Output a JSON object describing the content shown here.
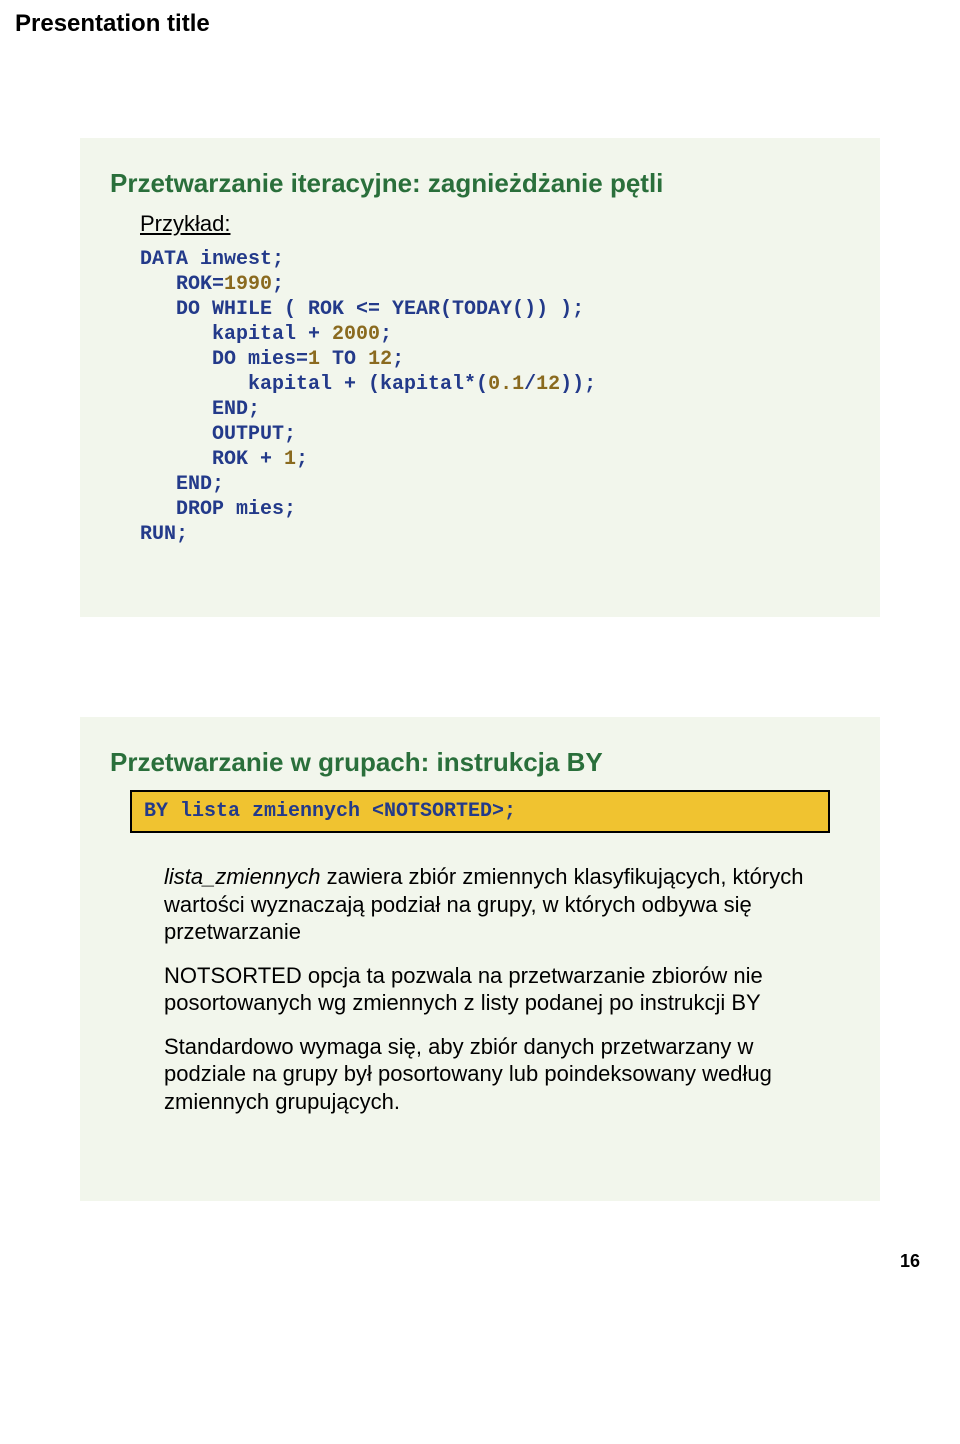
{
  "header": {
    "title": "Presentation title"
  },
  "slide1": {
    "title": "Przetwarzanie iteracyjne: zagnieżdżanie pętli",
    "example_label": "Przykład:",
    "code": {
      "l1a": "DATA",
      "l1b": " inwest;",
      "l2a": "   ROK=",
      "l2b": "1990",
      "l2c": ";",
      "l3a": "   DO WHILE ( ROK <= YEAR(TODAY()) );",
      "l4a": "      kapital + ",
      "l4b": "2000",
      "l4c": ";",
      "l5a": "      DO mies=",
      "l5b": "1",
      "l5c": " TO ",
      "l5d": "12",
      "l5e": ";",
      "l6a": "         kapital + (kapital*(",
      "l6b": "0.1",
      "l6c": "/",
      "l6d": "12",
      "l6e": "));",
      "l7": "      END;",
      "l8": "      OUTPUT;",
      "l9a": "      ROK + ",
      "l9b": "1",
      "l9c": ";",
      "l10": "   END;",
      "l11": "   DROP mies;",
      "l12": "RUN;"
    }
  },
  "slide2": {
    "title": "Przetwarzanie w grupach: instrukcja BY",
    "by_box": "BY lista zmiennych <NOTSORTED>;",
    "p1_term": "lista_zmiennych",
    "p1_rest": "      zawiera zbiór zmiennych klasyfikujących, których wartości wyznaczają podział na grupy, w których odbywa się przetwarzanie",
    "p2_term": "NOTSORTED",
    "p2_rest": "       opcja ta pozwala na przetwarzanie zbiorów nie posortowanych wg zmiennych z listy podanej po instrukcji BY",
    "p3": "Standardowo wymaga się, aby zbiór danych przetwarzany w podziale na grupy był posortowany lub poindeksowany według zmiennych grupujących."
  },
  "page_number": "16"
}
